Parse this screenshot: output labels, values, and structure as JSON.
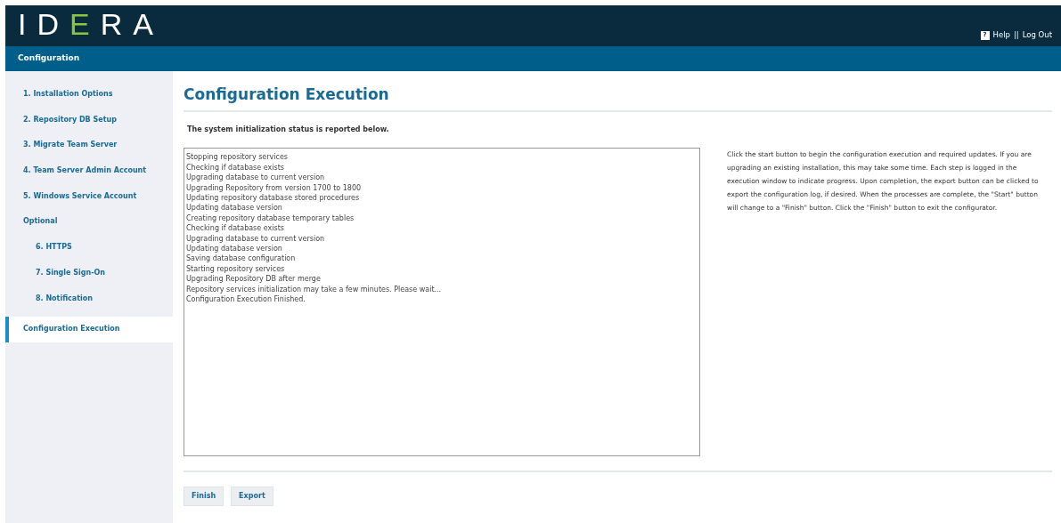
{
  "header": {
    "logo": "IDERA",
    "help_icon_text": "?",
    "links": [
      {
        "label": "Help"
      },
      {
        "label": "Log Out"
      }
    ],
    "separator": "||"
  },
  "subheader": {
    "title": "Configuration"
  },
  "sidebar": {
    "items": [
      {
        "label": "1. Installation Options",
        "selected": false
      },
      {
        "label": "2. Repository DB Setup",
        "selected": false
      },
      {
        "label": "3. Migrate Team Server",
        "selected": false
      },
      {
        "label": "4. Team Server Admin Account",
        "selected": false
      },
      {
        "label": "5. Windows Service Account",
        "selected": false
      },
      {
        "label": "Optional",
        "selected": false,
        "children": [
          {
            "label": "6. HTTPS",
            "selected": false
          },
          {
            "label": "7. Single Sign-On",
            "selected": false
          },
          {
            "label": "8. Notification",
            "selected": false
          }
        ]
      },
      {
        "label": "Configuration Execution",
        "selected": true
      }
    ]
  },
  "main": {
    "title": "Configuration Execution",
    "intro": "The system initialization status is reported below.",
    "log": [
      "Stopping repository services",
      "Checking if database exists",
      "Upgrading database to current version",
      "Upgrading Repository from version 1700 to 1800",
      "Updating repository database stored procedures",
      "Updating database version",
      "Creating repository database temporary tables",
      "Checking if database exists",
      "Upgrading database to current version",
      "Updating database version",
      "Saving database configuration",
      "Starting repository services",
      "Upgrading Repository DB after merge",
      "Repository services initialization may take a few minutes. Please wait...",
      "Configuration Execution Finished."
    ],
    "help_text": "Click the start button to begin the configuration execution and required updates. If you are upgrading an existing installation, this may take some time. Each step is logged in the execution window to indicate progress. Upon completion, the export button can be clicked to export the configuration log, if desired. When the processes are complete, the \"Start\" button will change to a \"Finish\" button. Click the \"Finish\" button to exit the configurator.",
    "buttons": [
      {
        "label": "Finish"
      },
      {
        "label": "Export"
      }
    ]
  }
}
